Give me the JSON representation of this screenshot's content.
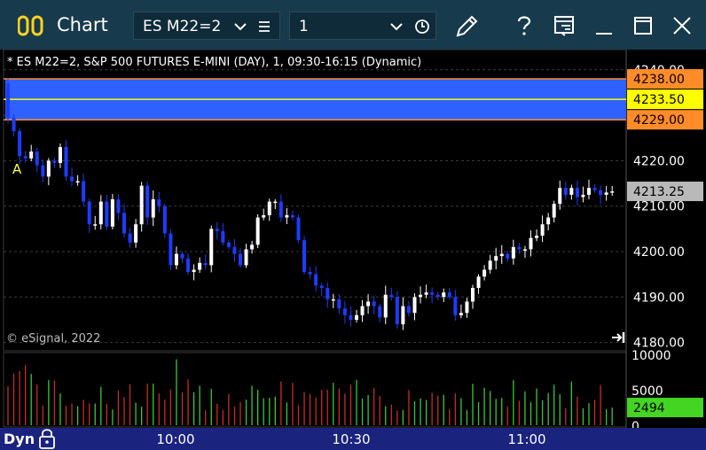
{
  "window": {
    "title": "Chart",
    "symbol": "ES M22=2",
    "interval": "1"
  },
  "chart": {
    "info_line": "* ES M22=2, S&P 500 FUTURES E-MINI (DAY), 1, 09:30-16:15 (Dynamic)",
    "watermark": "© eSignal, 2022",
    "annotation": "A",
    "dyn_label": "Dyn",
    "colors": {
      "up": "#ffffff",
      "down": "#1c3cff",
      "band_fill": "#2e61ff",
      "band_border": "#ff8c28",
      "mid_line": "#ffff00",
      "vol_up": "#38c838",
      "vol_down": "#c82a2a",
      "time_bar": "#1a237e"
    }
  },
  "chart_data": {
    "type": "candlestick",
    "price_axis": {
      "ticks": [
        "4240.00",
        "4220.00",
        "4210.00",
        "4200.00",
        "4190.00",
        "4180.00"
      ],
      "ylim": [
        4180,
        4240
      ]
    },
    "volume_axis": {
      "ticks": [
        "10000",
        "5000",
        "0"
      ],
      "ylim": [
        0,
        10000
      ]
    },
    "time_axis": {
      "ticks": [
        "10:00",
        "10:30",
        "11:00"
      ]
    },
    "price_labels": [
      {
        "value": 4238.0,
        "text": "4238.00",
        "style": "orange"
      },
      {
        "value": 4233.5,
        "text": "4233.50",
        "style": "yellow"
      },
      {
        "value": 4229.0,
        "text": "4229.00",
        "style": "orange"
      },
      {
        "value": 4213.25,
        "text": "4213.25",
        "style": "gray"
      }
    ],
    "volume_label": {
      "value": 2494,
      "text": "2494"
    },
    "band": {
      "upper": 4238.0,
      "mid": 4233.5,
      "lower": 4229.0
    },
    "closes": [
      4229.5,
      4226.5,
      4221,
      4220.5,
      4222,
      4219,
      4216.5,
      4220,
      4219.5,
      4223,
      4216.5,
      4215.5,
      4215.5,
      4211,
      4206,
      4206,
      4211,
      4205.5,
      4211.5,
      4208.5,
      4204,
      4202,
      4206,
      4214.5,
      4207.5,
      4211.5,
      4210,
      4204,
      4197,
      4199.5,
      4198.5,
      4195.5,
      4196,
      4197.5,
      4197,
      4205,
      4204.5,
      4202,
      4201,
      4199.5,
      4197,
      4200.5,
      4201.5,
      4207.5,
      4208,
      4211,
      4211,
      4207.5,
      4208,
      4207.5,
      4202.5,
      4195.5,
      4195,
      4192.5,
      4192,
      4189.5,
      4189.5,
      4187.5,
      4186,
      4185,
      4186,
      4188,
      4189,
      4188,
      4185.5,
      4190.5,
      4190,
      4184,
      4188,
      4186.5,
      4190,
      4190.5,
      4191,
      4190.5,
      4190,
      4191,
      4190,
      4186,
      4186.5,
      4189,
      4192,
      4194.5,
      4196,
      4198,
      4199,
      4199.5,
      4198.5,
      4201,
      4200.5,
      4200.5,
      4203,
      4203.5,
      4206,
      4207.5,
      4210.5,
      4214,
      4212.5,
      4214,
      4212,
      4212.5,
      4214,
      4213.5,
      4212.5,
      4213,
      4213.25
    ]
  }
}
